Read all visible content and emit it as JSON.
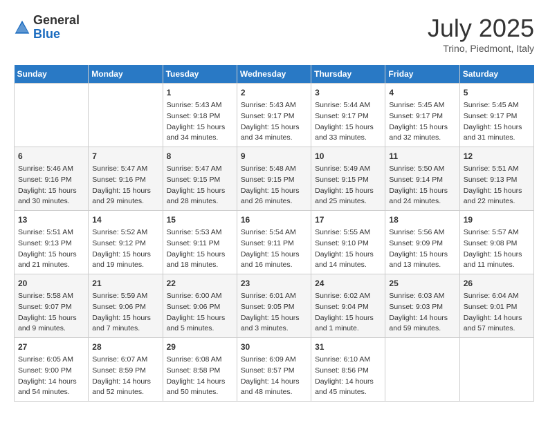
{
  "header": {
    "logo_general": "General",
    "logo_blue": "Blue",
    "month": "July 2025",
    "location": "Trino, Piedmont, Italy"
  },
  "days_of_week": [
    "Sunday",
    "Monday",
    "Tuesday",
    "Wednesday",
    "Thursday",
    "Friday",
    "Saturday"
  ],
  "weeks": [
    [
      {
        "day": "",
        "info": ""
      },
      {
        "day": "",
        "info": ""
      },
      {
        "day": "1",
        "info": "Sunrise: 5:43 AM\nSunset: 9:18 PM\nDaylight: 15 hours and 34 minutes."
      },
      {
        "day": "2",
        "info": "Sunrise: 5:43 AM\nSunset: 9:17 PM\nDaylight: 15 hours and 34 minutes."
      },
      {
        "day": "3",
        "info": "Sunrise: 5:44 AM\nSunset: 9:17 PM\nDaylight: 15 hours and 33 minutes."
      },
      {
        "day": "4",
        "info": "Sunrise: 5:45 AM\nSunset: 9:17 PM\nDaylight: 15 hours and 32 minutes."
      },
      {
        "day": "5",
        "info": "Sunrise: 5:45 AM\nSunset: 9:17 PM\nDaylight: 15 hours and 31 minutes."
      }
    ],
    [
      {
        "day": "6",
        "info": "Sunrise: 5:46 AM\nSunset: 9:16 PM\nDaylight: 15 hours and 30 minutes."
      },
      {
        "day": "7",
        "info": "Sunrise: 5:47 AM\nSunset: 9:16 PM\nDaylight: 15 hours and 29 minutes."
      },
      {
        "day": "8",
        "info": "Sunrise: 5:47 AM\nSunset: 9:15 PM\nDaylight: 15 hours and 28 minutes."
      },
      {
        "day": "9",
        "info": "Sunrise: 5:48 AM\nSunset: 9:15 PM\nDaylight: 15 hours and 26 minutes."
      },
      {
        "day": "10",
        "info": "Sunrise: 5:49 AM\nSunset: 9:15 PM\nDaylight: 15 hours and 25 minutes."
      },
      {
        "day": "11",
        "info": "Sunrise: 5:50 AM\nSunset: 9:14 PM\nDaylight: 15 hours and 24 minutes."
      },
      {
        "day": "12",
        "info": "Sunrise: 5:51 AM\nSunset: 9:13 PM\nDaylight: 15 hours and 22 minutes."
      }
    ],
    [
      {
        "day": "13",
        "info": "Sunrise: 5:51 AM\nSunset: 9:13 PM\nDaylight: 15 hours and 21 minutes."
      },
      {
        "day": "14",
        "info": "Sunrise: 5:52 AM\nSunset: 9:12 PM\nDaylight: 15 hours and 19 minutes."
      },
      {
        "day": "15",
        "info": "Sunrise: 5:53 AM\nSunset: 9:11 PM\nDaylight: 15 hours and 18 minutes."
      },
      {
        "day": "16",
        "info": "Sunrise: 5:54 AM\nSunset: 9:11 PM\nDaylight: 15 hours and 16 minutes."
      },
      {
        "day": "17",
        "info": "Sunrise: 5:55 AM\nSunset: 9:10 PM\nDaylight: 15 hours and 14 minutes."
      },
      {
        "day": "18",
        "info": "Sunrise: 5:56 AM\nSunset: 9:09 PM\nDaylight: 15 hours and 13 minutes."
      },
      {
        "day": "19",
        "info": "Sunrise: 5:57 AM\nSunset: 9:08 PM\nDaylight: 15 hours and 11 minutes."
      }
    ],
    [
      {
        "day": "20",
        "info": "Sunrise: 5:58 AM\nSunset: 9:07 PM\nDaylight: 15 hours and 9 minutes."
      },
      {
        "day": "21",
        "info": "Sunrise: 5:59 AM\nSunset: 9:06 PM\nDaylight: 15 hours and 7 minutes."
      },
      {
        "day": "22",
        "info": "Sunrise: 6:00 AM\nSunset: 9:06 PM\nDaylight: 15 hours and 5 minutes."
      },
      {
        "day": "23",
        "info": "Sunrise: 6:01 AM\nSunset: 9:05 PM\nDaylight: 15 hours and 3 minutes."
      },
      {
        "day": "24",
        "info": "Sunrise: 6:02 AM\nSunset: 9:04 PM\nDaylight: 15 hours and 1 minute."
      },
      {
        "day": "25",
        "info": "Sunrise: 6:03 AM\nSunset: 9:03 PM\nDaylight: 14 hours and 59 minutes."
      },
      {
        "day": "26",
        "info": "Sunrise: 6:04 AM\nSunset: 9:01 PM\nDaylight: 14 hours and 57 minutes."
      }
    ],
    [
      {
        "day": "27",
        "info": "Sunrise: 6:05 AM\nSunset: 9:00 PM\nDaylight: 14 hours and 54 minutes."
      },
      {
        "day": "28",
        "info": "Sunrise: 6:07 AM\nSunset: 8:59 PM\nDaylight: 14 hours and 52 minutes."
      },
      {
        "day": "29",
        "info": "Sunrise: 6:08 AM\nSunset: 8:58 PM\nDaylight: 14 hours and 50 minutes."
      },
      {
        "day": "30",
        "info": "Sunrise: 6:09 AM\nSunset: 8:57 PM\nDaylight: 14 hours and 48 minutes."
      },
      {
        "day": "31",
        "info": "Sunrise: 6:10 AM\nSunset: 8:56 PM\nDaylight: 14 hours and 45 minutes."
      },
      {
        "day": "",
        "info": ""
      },
      {
        "day": "",
        "info": ""
      }
    ]
  ]
}
